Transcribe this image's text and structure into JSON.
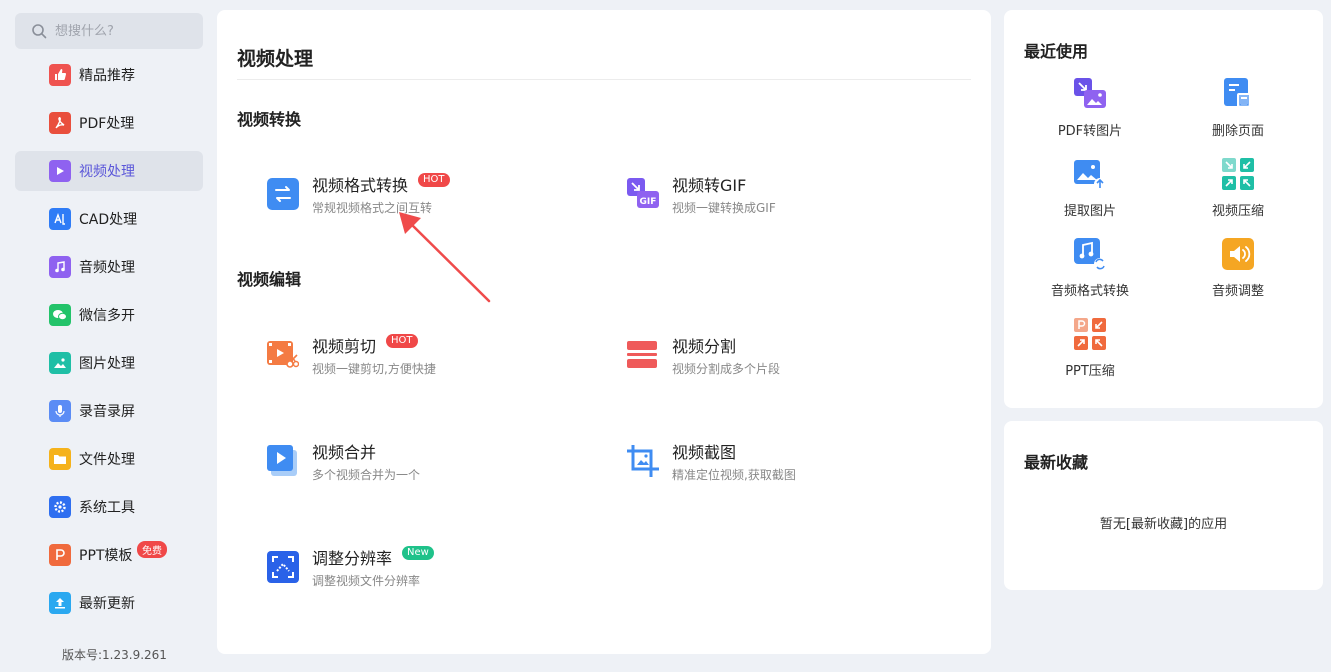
{
  "search": {
    "placeholder": "想搜什么?"
  },
  "sidebar": {
    "items": [
      {
        "label": "精品推荐",
        "icon": "thumbs-up-icon",
        "color": "#ef5350"
      },
      {
        "label": "PDF处理",
        "icon": "pdf-icon",
        "color": "#e94f3d"
      },
      {
        "label": "视频处理",
        "icon": "play-icon",
        "color": "#8f62f0",
        "active": true
      },
      {
        "label": "CAD处理",
        "icon": "cad-icon",
        "color": "#2f7cf6"
      },
      {
        "label": "音频处理",
        "icon": "music-icon",
        "color": "#8f62f0"
      },
      {
        "label": "微信多开",
        "icon": "wechat-icon",
        "color": "#23c36a"
      },
      {
        "label": "图片处理",
        "icon": "image-icon",
        "color": "#1fbfa6"
      },
      {
        "label": "录音录屏",
        "icon": "microphone-icon",
        "color": "#5b8cf5"
      },
      {
        "label": "文件处理",
        "icon": "folder-icon",
        "color": "#f5b21b"
      },
      {
        "label": "系统工具",
        "icon": "gear-icon",
        "color": "#2f6ff0"
      },
      {
        "label": "PPT模板",
        "icon": "ppt-icon",
        "color": "#f06a3d",
        "badge": "免费"
      },
      {
        "label": "最新更新",
        "icon": "upload-icon",
        "color": "#2aa8f0"
      }
    ],
    "version": "版本号:1.23.9.261"
  },
  "main": {
    "title": "视频处理",
    "sections": [
      {
        "title": "视频转换",
        "tools": [
          {
            "name": "视频格式转换",
            "desc": "常规视频格式之间互转",
            "badge": "HOT",
            "icon": "swap-arrows-icon"
          },
          {
            "name": "视频转GIF",
            "desc": "视频一键转换成GIF",
            "icon": "gif-icon"
          }
        ]
      },
      {
        "title": "视频编辑",
        "tools": [
          {
            "name": "视频剪切",
            "desc": "视频一键剪切,方便快捷",
            "badge": "HOT",
            "icon": "video-cut-icon"
          },
          {
            "name": "视频分割",
            "desc": "视频分割成多个片段",
            "icon": "split-icon"
          },
          {
            "name": "视频合并",
            "desc": "多个视频合并为一个",
            "icon": "merge-icon"
          },
          {
            "name": "视频截图",
            "desc": "精准定位视频,获取截图",
            "icon": "crop-icon"
          },
          {
            "name": "调整分辨率",
            "desc": "调整视频文件分辨率",
            "badge": "New",
            "icon": "resolution-icon"
          }
        ]
      }
    ]
  },
  "recent": {
    "title": "最近使用",
    "items": [
      {
        "label": "PDF转图片",
        "icon": "pdf-to-image-icon"
      },
      {
        "label": "删除页面",
        "icon": "delete-page-icon"
      },
      {
        "label": "提取图片",
        "icon": "extract-image-icon"
      },
      {
        "label": "视频压缩",
        "icon": "video-compress-icon"
      },
      {
        "label": "音频格式转换",
        "icon": "audio-convert-icon"
      },
      {
        "label": "音频调整",
        "icon": "speaker-icon"
      },
      {
        "label": "PPT压缩",
        "icon": "ppt-compress-icon"
      }
    ]
  },
  "favorites": {
    "title": "最新收藏",
    "empty_text": "暂无[最新收藏]的应用"
  }
}
